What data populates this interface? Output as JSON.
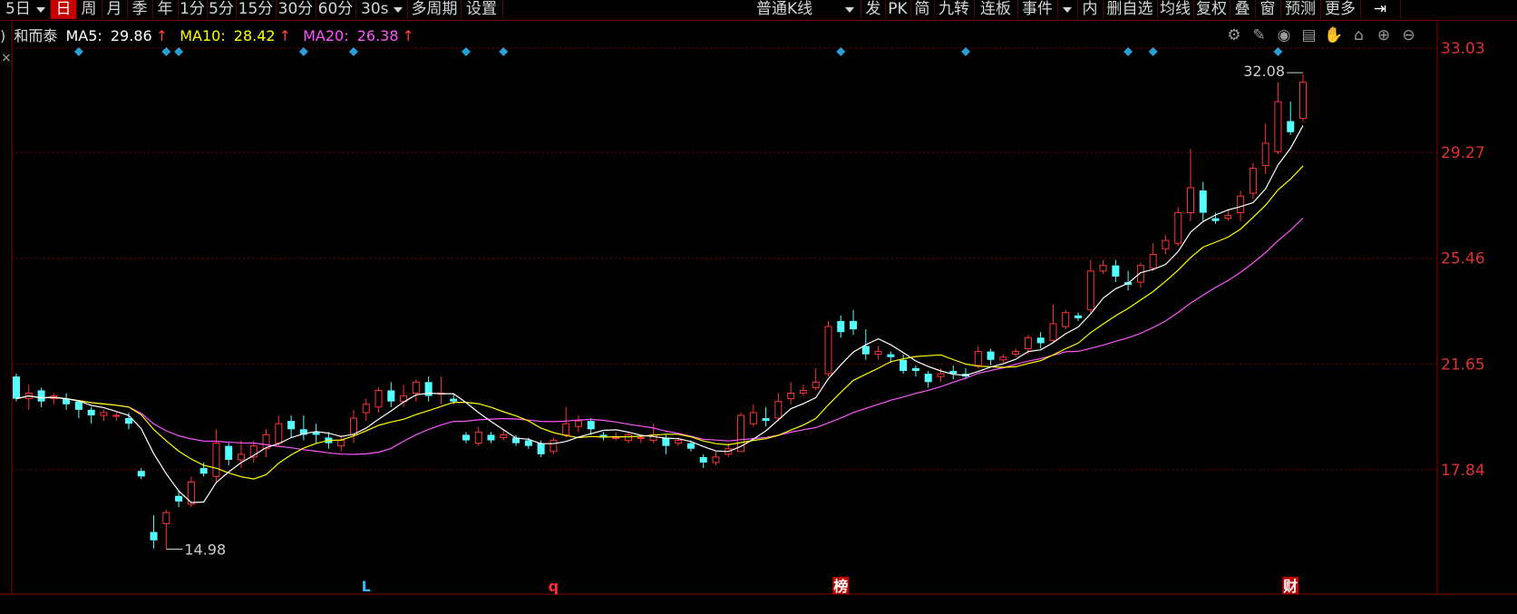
{
  "toolbar": {
    "items": [
      "5日",
      "日",
      "周",
      "月",
      "季",
      "年",
      "1分",
      "5分",
      "15分",
      "30分",
      "60分",
      "30s",
      "多周期",
      "设置"
    ],
    "active": "日",
    "kline_type": "普通K线",
    "right_items": [
      "发",
      "PK",
      "简",
      "九转",
      "连板",
      "事件",
      "内",
      "删自选",
      "均线",
      "复权",
      "叠",
      "窗",
      "预测",
      "更多"
    ]
  },
  "legend": {
    "stock_name": "和而泰",
    "ma5_label": "MA5:",
    "ma5": "29.86",
    "ma10_label": "MA10:",
    "ma10": "28.42",
    "ma20_label": "MA20:",
    "ma20": "26.38",
    "arrow": "↑"
  },
  "tools": [
    "gear-icon",
    "pencil-icon",
    "eye-icon",
    "briefcase-icon",
    "hand-icon",
    "lock-icon",
    "zoom-in-icon",
    "zoom-out-icon"
  ],
  "colors": {
    "up": "#ff3333",
    "down": "#54ffff",
    "ma5": "#ffffff",
    "ma10": "#ffff00",
    "ma20": "#ff55ff",
    "grid": "#7a0000"
  },
  "chart_data": {
    "type": "candlestick",
    "y_ticks": [
      "33.03",
      "29.27",
      "25.46",
      "21.65",
      "17.84"
    ],
    "ylim": [
      14.0,
      33.03
    ],
    "high_label": "32.08",
    "low_label": "14.98",
    "events": [
      {
        "label": "L",
        "color": "#33bbff",
        "index": 28
      },
      {
        "label": "q",
        "color": "#ff3333",
        "index": 43
      },
      {
        "label": "榜",
        "color": "#ffffff",
        "bg": "#c00000",
        "index": 66
      },
      {
        "label": "财",
        "color": "#ffffff",
        "bg": "#c00000",
        "index": 102
      }
    ],
    "markers": [
      5,
      12,
      13,
      23,
      27,
      36,
      39,
      66,
      76,
      89,
      91,
      101
    ],
    "candles": [
      [
        21.2,
        20.4,
        21.3,
        20.3
      ],
      [
        20.4,
        20.6,
        20.9,
        20.0
      ],
      [
        20.7,
        20.3,
        20.8,
        20.1
      ],
      [
        20.4,
        20.5,
        20.6,
        20.2
      ],
      [
        20.4,
        20.2,
        20.6,
        20.0
      ],
      [
        20.3,
        20.0,
        20.3,
        19.7
      ],
      [
        20.0,
        19.8,
        20.1,
        19.5
      ],
      [
        19.8,
        19.9,
        20.0,
        19.6
      ],
      [
        19.8,
        19.8,
        19.9,
        19.6
      ],
      [
        19.7,
        19.5,
        19.9,
        19.3
      ],
      [
        17.8,
        17.6,
        17.9,
        17.5
      ],
      [
        15.6,
        15.3,
        16.2,
        15.0
      ],
      [
        15.9,
        16.3,
        16.4,
        14.98
      ],
      [
        16.9,
        16.7,
        17.1,
        16.5
      ],
      [
        16.6,
        17.4,
        17.6,
        16.5
      ],
      [
        17.9,
        17.7,
        18.1,
        17.6
      ],
      [
        17.6,
        18.8,
        19.3,
        17.4
      ],
      [
        18.7,
        18.2,
        18.8,
        18.0
      ],
      [
        18.2,
        18.4,
        18.9,
        17.9
      ],
      [
        18.3,
        18.7,
        18.9,
        18.1
      ],
      [
        18.6,
        19.1,
        19.3,
        18.3
      ],
      [
        18.8,
        19.5,
        19.8,
        18.7
      ],
      [
        19.6,
        19.3,
        19.8,
        19.0
      ],
      [
        19.3,
        19.1,
        19.8,
        18.9
      ],
      [
        19.2,
        19.1,
        19.5,
        18.8
      ],
      [
        19.0,
        18.8,
        19.2,
        18.6
      ],
      [
        18.7,
        18.9,
        19.1,
        18.5
      ],
      [
        19.1,
        19.7,
        20.0,
        18.8
      ],
      [
        19.9,
        20.2,
        20.4,
        19.6
      ],
      [
        20.1,
        20.7,
        20.8,
        19.9
      ],
      [
        20.7,
        20.3,
        21.0,
        20.1
      ],
      [
        20.3,
        20.5,
        20.9,
        20.1
      ],
      [
        20.6,
        21.0,
        21.1,
        20.3
      ],
      [
        21.0,
        20.5,
        21.2,
        20.3
      ],
      [
        20.6,
        20.6,
        21.2,
        20.2
      ],
      [
        20.4,
        20.3,
        20.6,
        20.2
      ],
      [
        19.1,
        18.9,
        19.2,
        18.8
      ],
      [
        18.8,
        19.2,
        19.4,
        18.7
      ],
      [
        19.1,
        18.9,
        19.2,
        18.8
      ],
      [
        19.0,
        19.1,
        19.3,
        18.9
      ],
      [
        19.0,
        18.8,
        19.1,
        18.7
      ],
      [
        18.9,
        18.7,
        19.0,
        18.6
      ],
      [
        18.8,
        18.4,
        18.9,
        18.3
      ],
      [
        18.5,
        18.9,
        19.0,
        18.4
      ],
      [
        19.1,
        19.5,
        20.1,
        19.0
      ],
      [
        19.4,
        19.6,
        19.8,
        19.2
      ],
      [
        19.6,
        19.3,
        19.7,
        19.1
      ],
      [
        19.1,
        19.0,
        19.2,
        18.9
      ],
      [
        19.0,
        19.0,
        19.2,
        18.9
      ],
      [
        18.9,
        19.1,
        19.2,
        18.8
      ],
      [
        19.0,
        19.0,
        19.1,
        18.8
      ],
      [
        18.9,
        19.1,
        19.5,
        18.8
      ],
      [
        19.0,
        18.7,
        19.1,
        18.4
      ],
      [
        18.8,
        18.9,
        19.0,
        18.7
      ],
      [
        18.8,
        18.6,
        18.9,
        18.5
      ],
      [
        18.3,
        18.1,
        18.4,
        17.9
      ],
      [
        18.1,
        18.3,
        18.5,
        18.0
      ],
      [
        18.4,
        18.6,
        18.8,
        18.3
      ],
      [
        18.5,
        19.8,
        19.9,
        18.5
      ],
      [
        19.5,
        19.9,
        20.2,
        19.4
      ],
      [
        19.7,
        19.6,
        20.1,
        19.4
      ],
      [
        19.7,
        20.3,
        20.6,
        19.6
      ],
      [
        20.4,
        20.6,
        21.0,
        20.2
      ],
      [
        20.6,
        20.7,
        20.9,
        20.5
      ],
      [
        20.8,
        21.0,
        21.5,
        20.7
      ],
      [
        21.3,
        23.0,
        23.2,
        21.2
      ],
      [
        23.2,
        22.8,
        23.4,
        22.6
      ],
      [
        23.2,
        22.9,
        23.6,
        22.7
      ],
      [
        22.3,
        22.0,
        22.9,
        21.8
      ],
      [
        22.0,
        22.1,
        22.3,
        21.8
      ],
      [
        22.0,
        21.9,
        22.1,
        21.7
      ],
      [
        21.8,
        21.4,
        22.0,
        21.3
      ],
      [
        21.5,
        21.4,
        21.6,
        21.2
      ],
      [
        21.3,
        21.0,
        21.4,
        20.8
      ],
      [
        21.2,
        21.3,
        21.5,
        21.0
      ],
      [
        21.4,
        21.3,
        21.6,
        21.1
      ],
      [
        21.3,
        21.2,
        21.5,
        21.1
      ],
      [
        21.6,
        22.1,
        22.3,
        21.5
      ],
      [
        22.1,
        21.8,
        22.2,
        21.6
      ],
      [
        21.8,
        21.9,
        22.0,
        21.7
      ],
      [
        22.0,
        22.1,
        22.2,
        21.9
      ],
      [
        22.2,
        22.6,
        22.7,
        22.0
      ],
      [
        22.6,
        22.4,
        22.8,
        22.2
      ],
      [
        22.5,
        23.1,
        23.8,
        22.4
      ],
      [
        23.0,
        23.5,
        23.6,
        22.9
      ],
      [
        23.4,
        23.3,
        23.5,
        23.2
      ],
      [
        23.6,
        25.0,
        25.4,
        23.5
      ],
      [
        25.0,
        25.2,
        25.4,
        24.9
      ],
      [
        25.2,
        24.8,
        25.4,
        24.6
      ],
      [
        24.6,
        24.5,
        25.0,
        24.3
      ],
      [
        24.6,
        25.2,
        25.3,
        24.4
      ],
      [
        25.1,
        25.6,
        26.0,
        25.0
      ],
      [
        25.8,
        26.1,
        26.3,
        25.6
      ],
      [
        26.0,
        27.1,
        27.3,
        25.9
      ],
      [
        27.1,
        28.0,
        29.4,
        26.8
      ],
      [
        27.9,
        27.1,
        28.2,
        26.8
      ],
      [
        26.9,
        26.8,
        27.1,
        26.7
      ],
      [
        26.9,
        27.0,
        27.2,
        26.8
      ],
      [
        27.1,
        27.7,
        27.9,
        26.8
      ],
      [
        27.8,
        28.7,
        28.9,
        27.6
      ],
      [
        28.8,
        29.6,
        30.3,
        28.5
      ],
      [
        29.3,
        31.1,
        31.8,
        29.2
      ],
      [
        30.4,
        30.0,
        31.1,
        29.9
      ],
      [
        30.5,
        31.8,
        32.08,
        30.4
      ]
    ]
  }
}
